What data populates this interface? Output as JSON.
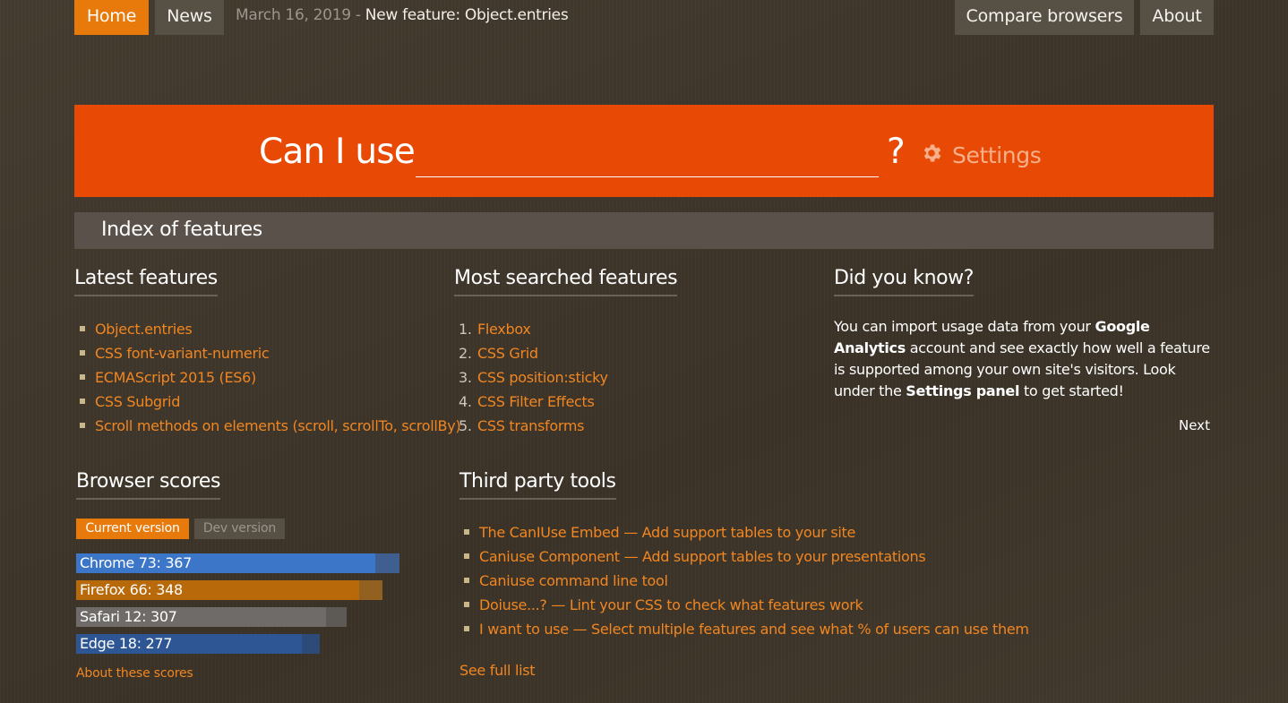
{
  "nav": {
    "home": "Home",
    "news": "News",
    "news_date": "March 16, 2019",
    "news_separator": " - ",
    "news_headline": "New feature: Object.entries",
    "compare": "Compare browsers",
    "about": "About"
  },
  "search": {
    "prefix": "Can I use",
    "value": "",
    "suffix": "?",
    "settings_label": "Settings",
    "settings_icon": "gear-icon"
  },
  "index": {
    "title": "Index of features"
  },
  "latest": {
    "title": "Latest features",
    "items": [
      "Object.entries",
      "CSS font-variant-numeric",
      "ECMAScript 2015 (ES6)",
      "CSS Subgrid",
      "Scroll methods on elements (scroll, scrollTo, scrollBy)"
    ]
  },
  "most_searched": {
    "title": "Most searched features",
    "items": [
      {
        "num": "1.",
        "label": "Flexbox"
      },
      {
        "num": "2.",
        "label": "CSS Grid"
      },
      {
        "num": "3.",
        "label": "CSS position:sticky"
      },
      {
        "num": "4.",
        "label": "CSS Filter Effects"
      },
      {
        "num": "5.",
        "label": "CSS transforms"
      }
    ]
  },
  "did_you_know": {
    "title": "Did you know?",
    "text_1": "You can import usage data from your ",
    "bold_1": "Google Analytics",
    "text_2": " account and see exactly how well a feature is supported among your own site's visitors. Look under the ",
    "bold_2": "Settings panel",
    "text_3": " to get started!",
    "next": "Next"
  },
  "browser_scores": {
    "title": "Browser scores",
    "tab_current": "Current version",
    "tab_dev": "Dev version",
    "max_score": 437,
    "scores": [
      {
        "label": "Chrome 73: 367",
        "value": 367,
        "color": "#3c76c9",
        "track": "#3e5f8f"
      },
      {
        "label": "Firefox 66: 348",
        "value": 348,
        "color": "#b86a0b",
        "track": "#92601f"
      },
      {
        "label": "Safari 12: 307",
        "value": 307,
        "color": "#6e6b68",
        "track": "#5d5a56"
      },
      {
        "label": "Edge 18: 277",
        "value": 277,
        "color": "#2e5694",
        "track": "#2e4a78"
      }
    ],
    "about_link": "About these scores"
  },
  "third_party": {
    "title": "Third party tools",
    "items": [
      "The CanIUse Embed — Add support tables to your site",
      "Caniuse Component — Add support tables to your presentations",
      "Caniuse command line tool",
      "Doiuse...? — Lint your CSS to check what features work",
      "I want to use — Select multiple features and see what % of users can use them"
    ],
    "see_full": "See full list"
  }
}
